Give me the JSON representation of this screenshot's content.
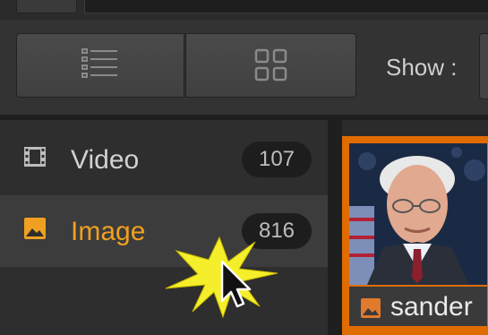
{
  "toolbar": {
    "list_view_icon": "list-view-icon",
    "grid_view_icon": "grid-view-icon",
    "show_label": "Show :"
  },
  "sidebar": {
    "items": [
      {
        "label": "Video",
        "count": "107",
        "icon": "film-icon",
        "selected": false
      },
      {
        "label": "Image",
        "count": "816",
        "icon": "image-icon",
        "selected": true
      }
    ]
  },
  "thumbnail": {
    "caption": "sander",
    "icon": "image-icon",
    "selected": true
  },
  "colors": {
    "accent": "#f0a020",
    "selection_border": "#e06c00",
    "background": "#2b2b2b"
  }
}
